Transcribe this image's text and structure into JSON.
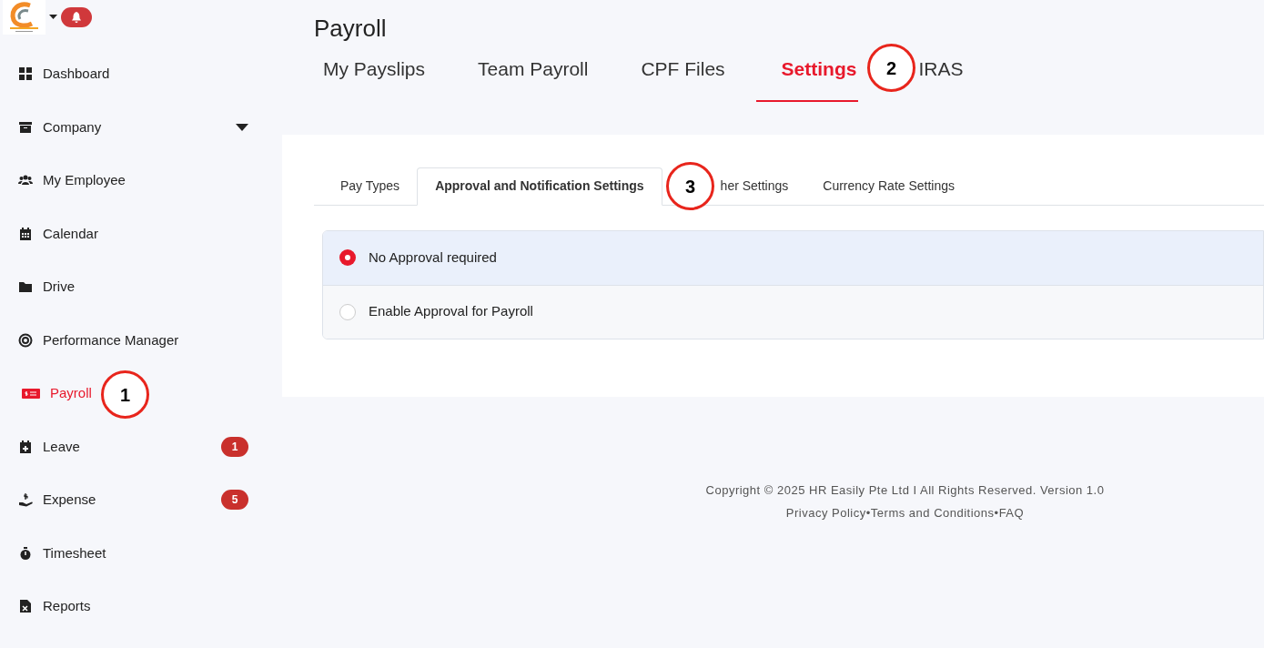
{
  "header": {
    "notifications_badge": true
  },
  "sidebar": {
    "items": [
      {
        "label": "Dashboard",
        "selected": false
      },
      {
        "label": "Company",
        "selected": false,
        "dropdown": true
      },
      {
        "label": "My Employee",
        "selected": false
      },
      {
        "label": "Calendar",
        "selected": false
      },
      {
        "label": "Drive",
        "selected": false
      },
      {
        "label": "Performance Manager",
        "selected": false
      },
      {
        "label": "Payroll",
        "selected": true
      },
      {
        "label": "Leave",
        "selected": false,
        "badge": "1"
      },
      {
        "label": "Expense",
        "selected": false,
        "badge": "5"
      },
      {
        "label": "Timesheet",
        "selected": false
      },
      {
        "label": "Reports",
        "selected": false
      }
    ]
  },
  "page": {
    "title": "Payroll",
    "tabs": [
      {
        "label": "My Payslips",
        "selected": false
      },
      {
        "label": "Team Payroll",
        "selected": false
      },
      {
        "label": "CPF Files",
        "selected": false
      },
      {
        "label": "Settings",
        "selected": true
      },
      {
        "label": "IRAS",
        "selected": false
      }
    ],
    "sub_tabs": [
      {
        "label": "Pay Types",
        "selected": false
      },
      {
        "label": "Approval and Notification Settings",
        "selected": true
      },
      {
        "label": "her Settings",
        "selected": false
      },
      {
        "label": "Currency Rate Settings",
        "selected": false
      }
    ],
    "options": [
      {
        "label": "No Approval required",
        "selected": true
      },
      {
        "label": "Enable Approval for Payroll",
        "selected": false
      }
    ]
  },
  "callouts": [
    {
      "number": "1"
    },
    {
      "number": "2"
    },
    {
      "number": "3"
    }
  ],
  "footer": {
    "copyright": "Copyright © 2025 HR Easily Pte Ltd I All Rights Reserved. Version 1.0",
    "links": [
      "Privacy Policy",
      "Terms and Conditions",
      "FAQ"
    ],
    "separator": "•"
  }
}
